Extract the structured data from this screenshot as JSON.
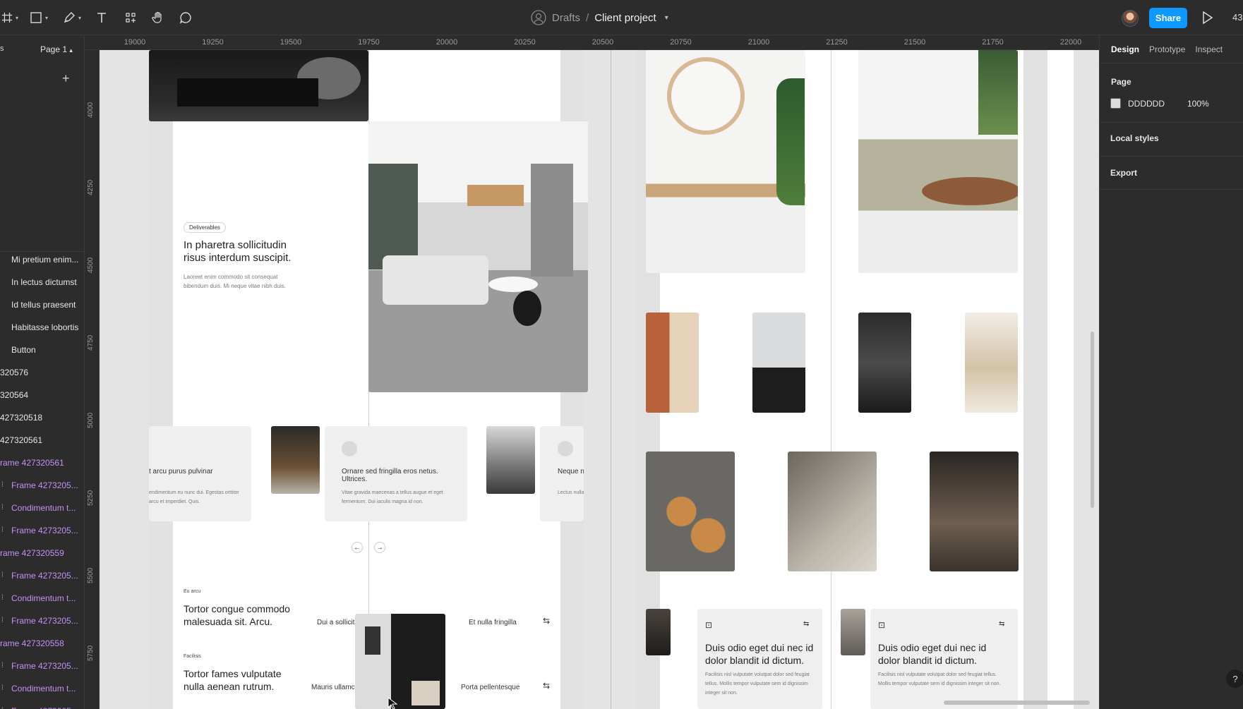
{
  "toolbar": {
    "breadcrumb_team": "Drafts",
    "breadcrumb_sep": "/",
    "project_name": "Client project",
    "share_label": "Share",
    "zoom_partial": "43"
  },
  "left_panel": {
    "tab_partial": "s",
    "page_selector": "Page 1",
    "layers": [
      {
        "name": "Mi pretium enim...",
        "color": "white"
      },
      {
        "name": "In lectus dictumst",
        "color": "white"
      },
      {
        "name": "Id tellus praesent",
        "color": "white"
      },
      {
        "name": "Habitasse lobortis",
        "color": "white"
      },
      {
        "name": "Button",
        "color": "white"
      },
      {
        "name": "320576",
        "color": "white"
      },
      {
        "name": "320564",
        "color": "white"
      },
      {
        "name": "427320518",
        "color": "white"
      },
      {
        "name": "427320561",
        "color": "white"
      },
      {
        "name": "rame 427320561",
        "color": "purple"
      },
      {
        "name": "Frame 4273205...",
        "color": "purple"
      },
      {
        "name": "Condimentum t...",
        "color": "purple"
      },
      {
        "name": "Frame 4273205...",
        "color": "purple"
      },
      {
        "name": "rame 427320559",
        "color": "purple"
      },
      {
        "name": "Frame 4273205...",
        "color": "purple"
      },
      {
        "name": "Condimentum t...",
        "color": "purple"
      },
      {
        "name": "Frame 4273205...",
        "color": "purple"
      },
      {
        "name": "rame 427320558",
        "color": "purple"
      },
      {
        "name": "Frame 4273205...",
        "color": "purple"
      },
      {
        "name": "Condimentum t...",
        "color": "purple"
      },
      {
        "name": "Frame 4273205...",
        "color": "purple"
      }
    ]
  },
  "rulers": {
    "x_ticks": [
      "19000",
      "19250",
      "19500",
      "19750",
      "20000",
      "20250",
      "20500",
      "20750",
      "21000",
      "21250",
      "21500",
      "21750",
      "22000"
    ],
    "y_ticks": [
      "4000",
      "4250",
      "4500",
      "4750",
      "5000",
      "5250",
      "5500",
      "5750"
    ]
  },
  "canvas": {
    "deliverables_tag": "Deliverables",
    "hero_title": "In pharetra sollicitudin risus interdum suscipit.",
    "hero_body": "Laoreet enim commodo sit consequat bibendum duis. Mi neque vitae nibh duis.",
    "card1_title": "t arcu purus pulvinar",
    "card1_body": "endimentum eu nunc dui. Egestas orttitor arcu et imperdiet. Quis.",
    "card2_title": "Ornare sed fringilla eros netus. Ultrices.",
    "card2_body": "Vitae gravida maecenas a tellus augue et eget fermentum. Dui iaculis magna id non.",
    "card3_title": "Neque nit aliquam n",
    "card3_body": "Lectus nulla ac ullamcorper q",
    "prev_arrow": "←",
    "next_arrow": "→",
    "section1_label": "Eu arcu",
    "section1_title": "Tortor congue commodo malesuada sit. Arcu.",
    "section1_left": "Dui a sollicit",
    "section1_right": "Et nulla fringilla",
    "section2_label": "Facilisis",
    "section2_title": "Tortor fames vulputate nulla aenean rutrum.",
    "section2_left": "Mauris ullamc",
    "section2_right": "Porta pellentesque",
    "link_icon": "⇆",
    "rcard_title": "Duis odio eget dui nec id dolor blandit id dictum.",
    "rcard_body": "Facilisis nisl vulputate volutpat dolor sed feugiat tellus. Mollis tempor vulputate sem id dignissim integer sit non.",
    "inbox_icon": "⊡"
  },
  "right_panel": {
    "tabs": [
      "Design",
      "Prototype",
      "Inspect"
    ],
    "page_heading": "Page",
    "page_color_hex": "DDDDDD",
    "page_color_opacity": "100%",
    "local_styles": "Local styles",
    "export": "Export",
    "help": "?"
  },
  "colors": {
    "accent": "#0d99ff",
    "layer_purple": "#c391f5",
    "page_bg": "#DDDDDD"
  }
}
